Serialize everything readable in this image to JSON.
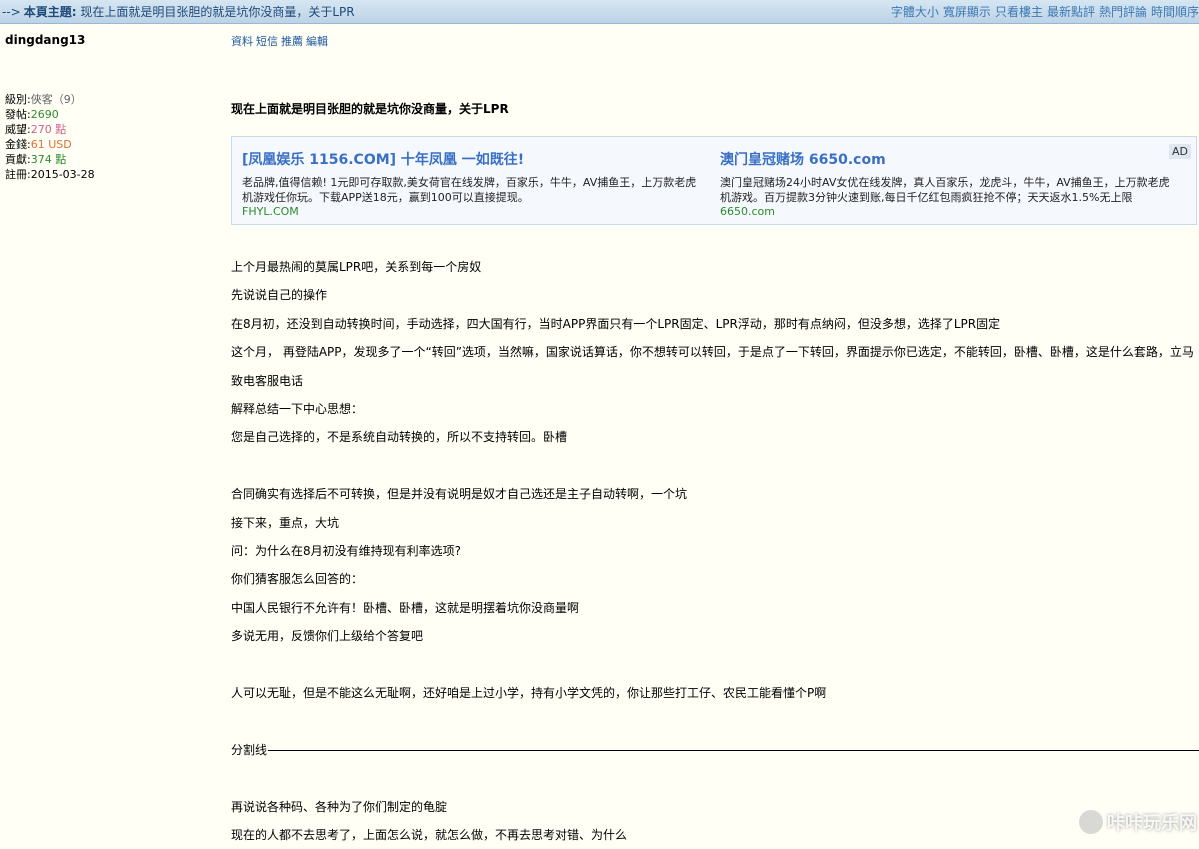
{
  "topbar": {
    "arrow": "-->",
    "label": "本頁主題:",
    "subject": "现在上面就是明目张胆的就是坑你没商量，关于LPR",
    "actions": [
      "字體大小",
      "寬屏顯示",
      "只看樓主",
      "最新點評",
      "熱門評論",
      "時間順序"
    ]
  },
  "user": {
    "name": "dingdang13",
    "stats": [
      {
        "label": "級別:",
        "value": "俠客（9）",
        "color": "#666666"
      },
      {
        "label": "發帖:",
        "value": "2690",
        "color": "#2e8b2e"
      },
      {
        "label": "威望:",
        "value": "270 點",
        "color": "#d06090"
      },
      {
        "label": "金錢:",
        "value": "61 USD",
        "color": "#e07030"
      },
      {
        "label": "貢獻:",
        "value": "374 點",
        "color": "#2e8b2e"
      },
      {
        "label": "註冊:",
        "value": "2015-03-28",
        "color": "#000000"
      }
    ]
  },
  "links": [
    "資料",
    "短信",
    "推薦",
    "編輯"
  ],
  "post": {
    "title": "现在上面就是明目张胆的就是坑你没商量，关于LPR",
    "ad": {
      "badge": "AD",
      "items": [
        {
          "title": "[凤凰娱乐 1156.COM] 十年凤凰 一如既往!",
          "text": "老品牌,值得信赖! 1元即可存取款,美女荷官在线发牌，百家乐，牛牛，AV捕鱼王，上万款老虎机游戏任你玩。下载APP送18元，赢到100可以直接提现。",
          "url": "FHYL.COM"
        },
        {
          "title": "澳门皇冠赌场 6650.com",
          "text": "澳门皇冠赌场24小时AV女优在线发牌，真人百家乐，龙虎斗，牛牛，AV捕鱼王，上万款老虎机游戏。百万提款3分钟火速到账,每日千亿红包雨疯狂抢不停；天天返水1.5%无上限",
          "url": "6650.com"
        }
      ]
    },
    "lines": {
      "l1": "上个月最热闹的莫属LPR吧，关系到每一个房奴",
      "l2": "先说说自己的操作",
      "l3": "在8月初，还没到自动转换时间，手动选择，四大国有行，当时APP界面只有一个LPR固定、LPR浮动，那时有点纳闷，但没多想，选择了LPR固定",
      "l4": "这个月， 再登陆APP，发现多了一个“转回”选项，当然嘛，国家说话算话，你不想转可以转回，于是点了一下转回，界面提示你已选定，不能转回，卧槽、卧槽，这是什么套路，立马致电客服电话",
      "l5": "解释总结一下中心思想：",
      "l6": "您是自己选择的，不是系统自动转换的，所以不支持转回。卧槽",
      "l7": "合同确实有选择后不可转换，但是并没有说明是奴才自己选还是主子自动转啊，一个坑",
      "l8": "接下来，重点，大坑",
      "l9": "问：为什么在8月初没有维持现有利率选项?",
      "l10": "你们猜客服怎么回答的：",
      "l11": "中国人民银行不允许有！卧槽、卧槽，这就是明摆着坑你没商量啊",
      "l12": "多说无用，反馈你们上级给个答复吧",
      "l13": "人可以无耻，但是不能这么无耻啊，还好咱是上过小学，持有小学文凭的，你让那些打工仔、农民工能看懂个P啊",
      "l14": "分割线",
      "l15": "再说说各种码、各种为了你们制定的龟腚",
      "l16": "现在的人都不去思考了，上面怎么说，就怎么做，不再去思考对错、为什么"
    }
  },
  "watermark": "咔咔玩乐网"
}
